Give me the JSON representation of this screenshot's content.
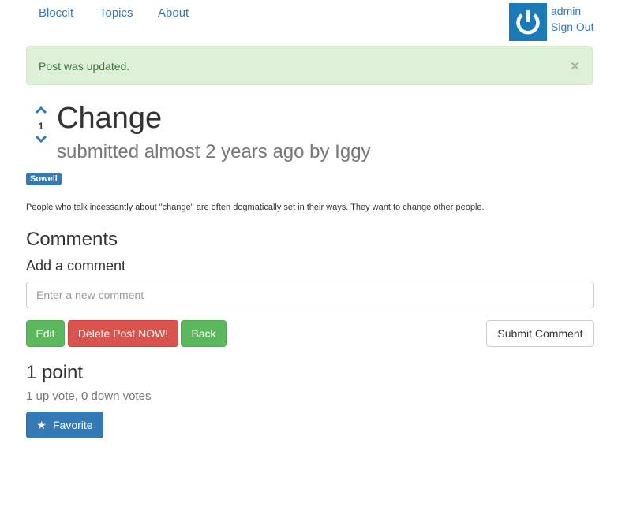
{
  "navbar": {
    "brand": "Bloccit",
    "links": [
      "Topics",
      "About"
    ],
    "user": {
      "name": "admin",
      "sign_out": "Sign Out"
    }
  },
  "alert": {
    "message": "Post was updated.",
    "close": "×"
  },
  "post": {
    "votes": "1",
    "title": "Change",
    "meta": "submitted almost 2 years ago by Iggy",
    "topic": "Sowell",
    "body": "People who talk incessantly about \"change\" are often dogmatically set in their ways. They want to change other people."
  },
  "comments": {
    "heading": "Comments",
    "add_heading": "Add a comment",
    "placeholder": "Enter a new comment",
    "submit_label": "Submit Comment"
  },
  "actions": {
    "edit": "Edit",
    "delete": "Delete Post NOW!",
    "back": "Back"
  },
  "score": {
    "points": "1 point",
    "summary": "1 up vote, 0 down votes",
    "favorite": "Favorite"
  },
  "icons": {
    "avatar": "power-icon",
    "vote_up": "chevron-up-icon",
    "vote_down": "chevron-down-icon",
    "favorite": "star-icon"
  },
  "colors": {
    "link": "#337ab7",
    "success": "#5cb85c",
    "danger": "#d9534f",
    "primary": "#337ab7",
    "alert_bg": "#dff0d8",
    "alert_text": "#3c763d"
  }
}
